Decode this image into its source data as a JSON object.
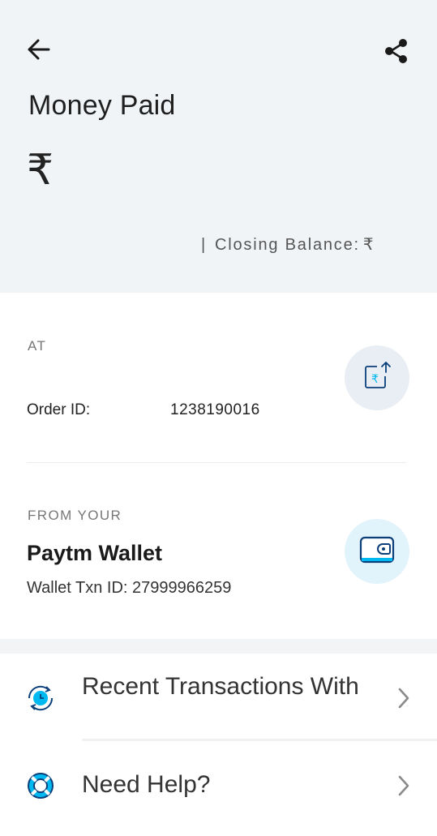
{
  "header": {
    "title": "Money Paid",
    "currency_symbol": "₹",
    "closing_balance_label": "Closing Balance:",
    "closing_balance_currency": "₹",
    "separator": "|",
    "back_icon": "arrow-left-icon",
    "share_icon": "share-icon"
  },
  "payee": {
    "label": "AT",
    "order_id_label": "Order ID:",
    "order_id_value": "1238190016",
    "icon": "rupee-payment-icon"
  },
  "source": {
    "label": "FROM YOUR",
    "name": "Paytm Wallet",
    "txn_id_text": "Wallet Txn ID: 27999966259",
    "icon": "wallet-icon"
  },
  "actions": [
    {
      "label": "Recent Transactions With",
      "icon": "recent-transactions-icon"
    },
    {
      "label": "Need Help?",
      "icon": "lifebuoy-help-icon"
    }
  ],
  "colors": {
    "header_bg": "#f1f4f7",
    "accent_blue": "#00b9f1",
    "dark_blue": "#0b3f7a"
  }
}
